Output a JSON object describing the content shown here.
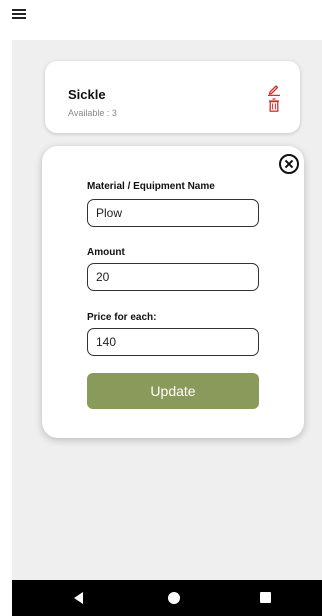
{
  "header": {
    "menu_icon": "hamburger-icon"
  },
  "item_list": {
    "items": [
      {
        "name": "Sickle",
        "available": "Available : 3",
        "edit_icon": "pencil-icon",
        "delete_icon": "trash-icon"
      }
    ]
  },
  "edit_form": {
    "close_icon": "close-circle-icon",
    "name_label": "Material / Equipment Name",
    "name_value": "Plow",
    "amount_label": "Amount",
    "amount_value": "20",
    "price_label": "Price for each:",
    "price_value": "140",
    "update_label": "Update"
  },
  "nav_bar": {
    "back_icon": "back-triangle-icon",
    "home_icon": "home-circle-icon",
    "recents_icon": "recents-square-icon"
  },
  "colors": {
    "accent": "#8a9a5b",
    "delete": "#d32f2f",
    "background": "#efefef",
    "nav_background": "#000000"
  }
}
